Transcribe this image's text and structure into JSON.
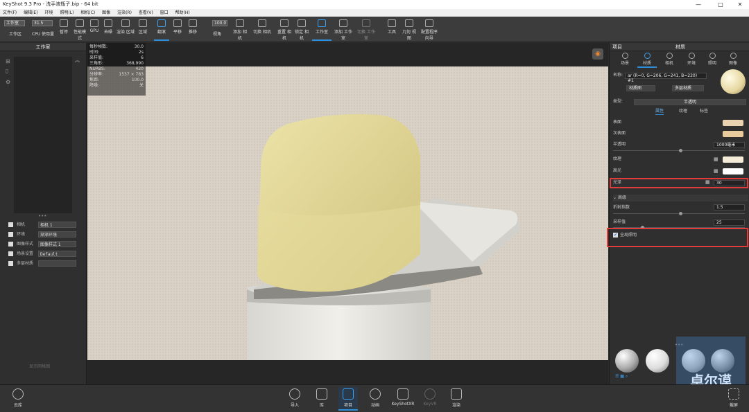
{
  "window": {
    "title": "KeyShot 9.3 Pro - 洗手液瓶子.bip - 64 bit",
    "min": "—",
    "max": "□",
    "close": "✕"
  },
  "menu": [
    "文件(F)",
    "编辑(E)",
    "环境",
    "照明(L)",
    "相机(C)",
    "图像",
    "渲染(R)",
    "查看(V)",
    "窗口",
    "帮助(H)"
  ],
  "toolbar": {
    "workspace_select": "工作室",
    "cpu_value": "31.5",
    "zoom_value": "100.0",
    "buttons": [
      "工作区",
      "CPU 使用量",
      "暂停",
      "性能模式",
      "GPU",
      "去噪",
      "渲染 区域",
      "区域",
      "翻滚",
      "平移",
      "推移",
      "视角",
      "添加 相机",
      "切换 相机",
      "重置 相机",
      "锁定 相机",
      "工作室",
      "添加 工作室",
      "切换 工作室",
      "工具",
      "几何 视图",
      "配置程序 向导"
    ]
  },
  "left_panel": {
    "title": "工作室",
    "empty_text": "显示网格图",
    "rows": [
      {
        "label": "相机",
        "value": "相机 1"
      },
      {
        "label": "环境",
        "value": "渐渐环境"
      },
      {
        "label": "图像样式",
        "value": "图像样式 1"
      },
      {
        "label": "场景设置",
        "value": "Default"
      },
      {
        "label": "多层材质",
        "value": ""
      }
    ]
  },
  "stats": [
    {
      "label": "每秒帧数:",
      "value": "30.0"
    },
    {
      "label": "时间:",
      "value": "2s"
    },
    {
      "label": "采样值:",
      "value": "6"
    },
    {
      "label": "三角形:",
      "value": "368,990"
    },
    {
      "label": "NURBS:",
      "value": "420"
    },
    {
      "label": "分辨率:",
      "value": "1537 × 783"
    },
    {
      "label": "焦距:",
      "value": "100.0"
    },
    {
      "label": "降噪:",
      "value": "关"
    }
  ],
  "right_panel": {
    "tab_left": "项目",
    "tab_right": "材质",
    "tabs": [
      "场景",
      "材质",
      "相机",
      "环境",
      "照明",
      "图像"
    ],
    "name_label": "名称:",
    "name_value": "ar (R=0, G=206, G=241, B=220) #1",
    "btn_material_graph": "材质图",
    "btn_multi_material": "多层材质",
    "type_label": "类型:",
    "type_value": "半透明",
    "subtabs": [
      "属性",
      "纹理",
      "标签"
    ],
    "props": {
      "surface": "表面",
      "subsurface": "次表面",
      "translucency": "半透明",
      "translucency_value": "1000毫米",
      "texture": "纹理",
      "specular": "高光",
      "roughness": "光泽",
      "roughness_value": "30",
      "advanced": "高级",
      "refraction": "折射指数",
      "refraction_value": "1.5",
      "samples": "采样值",
      "samples_value": "25",
      "global_illumination": "全局照明"
    },
    "colors": {
      "surface": "#e8d2b0",
      "subsurface": "#e8ca9c",
      "texture": "#f4ecd8",
      "specular": "#ffffff"
    }
  },
  "bottom": {
    "cloud": "云库",
    "buttons": [
      "导入",
      "库",
      "项目",
      "动画",
      "KeyShotXR",
      "KeyVR",
      "渲染"
    ],
    "screenshot": "截屏"
  },
  "watermark": "卓尔谟",
  "colors": {
    "accent": "#2f8fdb",
    "highlight": "#e23b3b"
  }
}
